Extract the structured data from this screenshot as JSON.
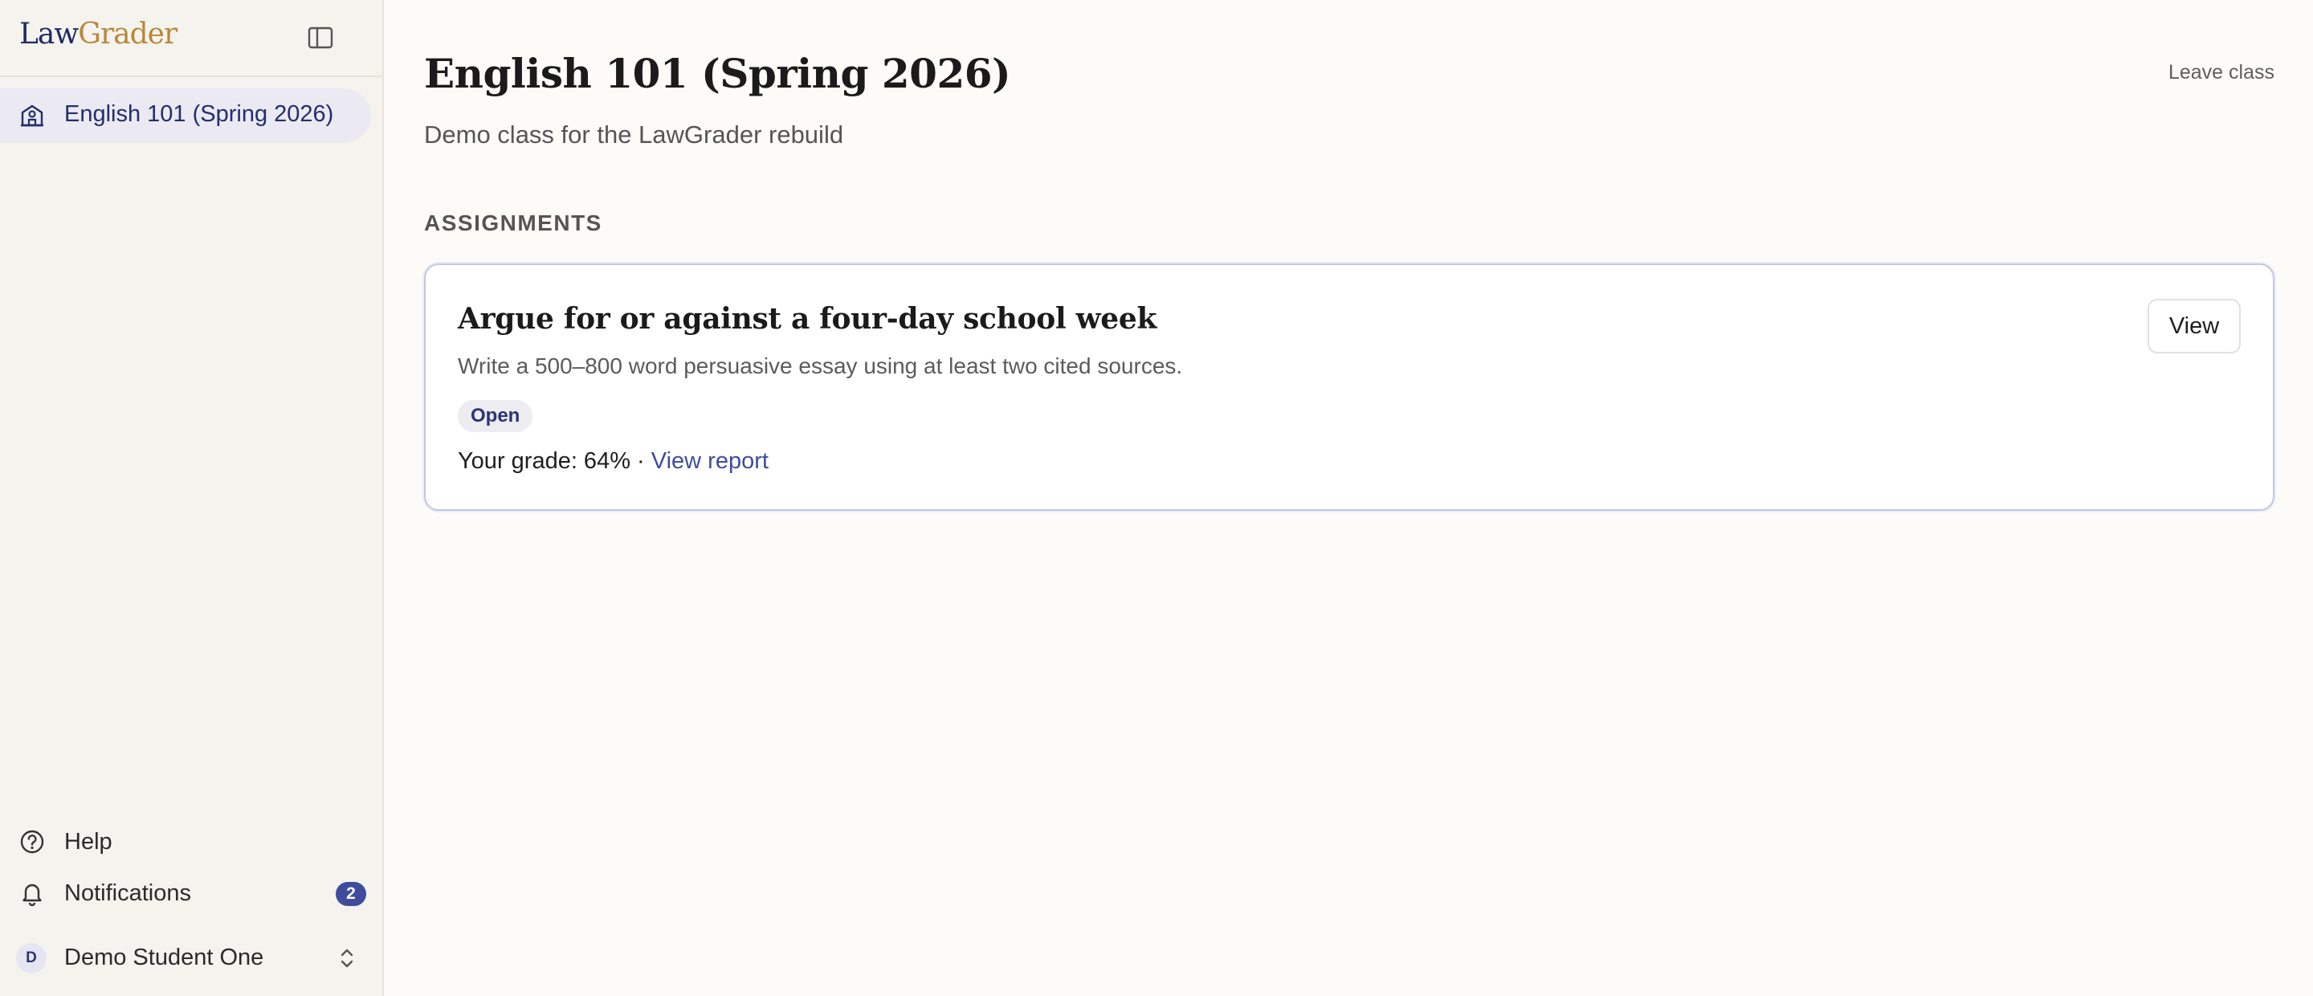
{
  "app": {
    "logo_part1": "Law",
    "logo_part2": "Grader",
    "colors": {
      "brand_navy": "#1f2a66",
      "brand_gold": "#b9873a",
      "accent": "#3f4c9e"
    }
  },
  "sidebar": {
    "collapse_icon": "panel-left-icon",
    "nav": [
      {
        "label": "English 101 (Spring 2026)",
        "icon": "school-icon",
        "active": true
      }
    ],
    "help_label": "Help",
    "notifications_label": "Notifications",
    "notifications_count": "2",
    "user": {
      "initial": "D",
      "name": "Demo Student One"
    }
  },
  "main": {
    "title": "English 101 (Spring 2026)",
    "subtitle": "Demo class for the LawGrader rebuild",
    "leave_label": "Leave class",
    "section_heading": "ASSIGNMENTS",
    "assignments": [
      {
        "title": "Argue for or against a four-day school week",
        "description": "Write a 500–800 word persuasive essay using at least two cited sources.",
        "status": "Open",
        "grade_prefix": "Your grade: 64% · ",
        "report_label": "View report",
        "view_label": "View"
      }
    ]
  }
}
